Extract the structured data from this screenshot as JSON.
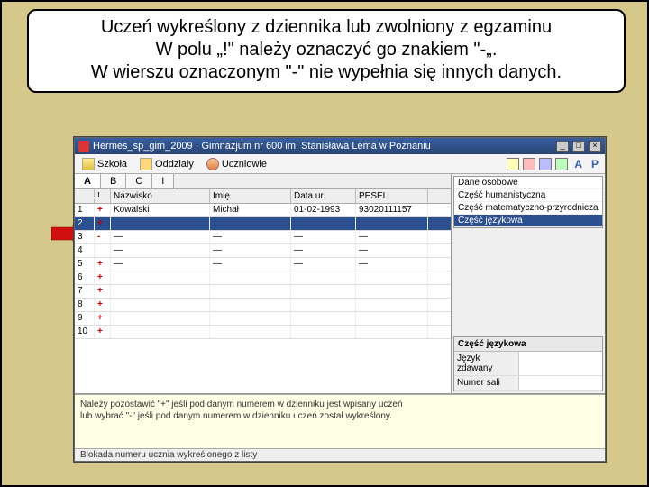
{
  "note": {
    "line1": "Uczeń wykreślony z dziennika lub zwolniony z egzaminu",
    "line2": "W polu „!\" należy oznaczyć go znakiem \"-„.",
    "line3": "W wierszu oznaczonym \"-\" nie wypełnia się innych danych."
  },
  "window": {
    "title": "Hermes_sp_gim_2009 · Gimnazjum nr 600 im. Stanisława Lema w Poznaniu"
  },
  "toolbar": {
    "school": "Szkoła",
    "classes": "Oddziały",
    "students": "Uczniowie",
    "letterA": "A",
    "letterP": "P"
  },
  "tabs": {
    "a": "A",
    "b": "B",
    "c": "C",
    "i": "I"
  },
  "grid": {
    "headers": {
      "num": "",
      "excl": "!",
      "surname": "Nazwisko",
      "name": "Imię",
      "dob": "Data ur.",
      "pesel": "PESEL"
    },
    "rows": [
      {
        "n": "1",
        "e": "+",
        "surname": "Kowalski",
        "name": "Michał",
        "dob": "01-02-1993",
        "pesel": "93020111157"
      },
      {
        "n": "2",
        "e": "+",
        "surname": "",
        "name": "",
        "dob": "",
        "pesel": ""
      },
      {
        "n": "3",
        "e": "-",
        "surname": "—",
        "name": "—",
        "dob": "—",
        "pesel": "—"
      },
      {
        "n": "4",
        "e": "",
        "surname": "—",
        "name": "—",
        "dob": "—",
        "pesel": "—"
      },
      {
        "n": "5",
        "e": "+",
        "surname": "—",
        "name": "—",
        "dob": "—",
        "pesel": "—"
      },
      {
        "n": "6",
        "e": "+",
        "surname": "",
        "name": "",
        "dob": "",
        "pesel": ""
      },
      {
        "n": "7",
        "e": "+",
        "surname": "",
        "name": "",
        "dob": "",
        "pesel": ""
      },
      {
        "n": "8",
        "e": "+",
        "surname": "",
        "name": "",
        "dob": "",
        "pesel": ""
      },
      {
        "n": "9",
        "e": "+",
        "surname": "",
        "name": "",
        "dob": "",
        "pesel": ""
      },
      {
        "n": "10",
        "e": "+",
        "surname": "",
        "name": "",
        "dob": "",
        "pesel": ""
      }
    ]
  },
  "side": {
    "list": [
      "Dane osobowe",
      "Część humanistyczna",
      "Część matematyczno-przyrodnicza",
      "Część językowa"
    ],
    "selectedIndex": 3,
    "section_title": "Część językowa",
    "rows": [
      {
        "label": "Język zdawany",
        "value": ""
      },
      {
        "label": "Numer sali",
        "value": ""
      }
    ]
  },
  "info": {
    "line1": "Należy pozostawić \"+\" jeśli pod danym numerem w dzienniku jest wpisany uczeń",
    "line2": "lub wybrać \"-\" jeśli pod danym numerem w dzienniku uczeń został wykreślony."
  },
  "status": "Blokada numeru ucznia wykreślonego z listy"
}
